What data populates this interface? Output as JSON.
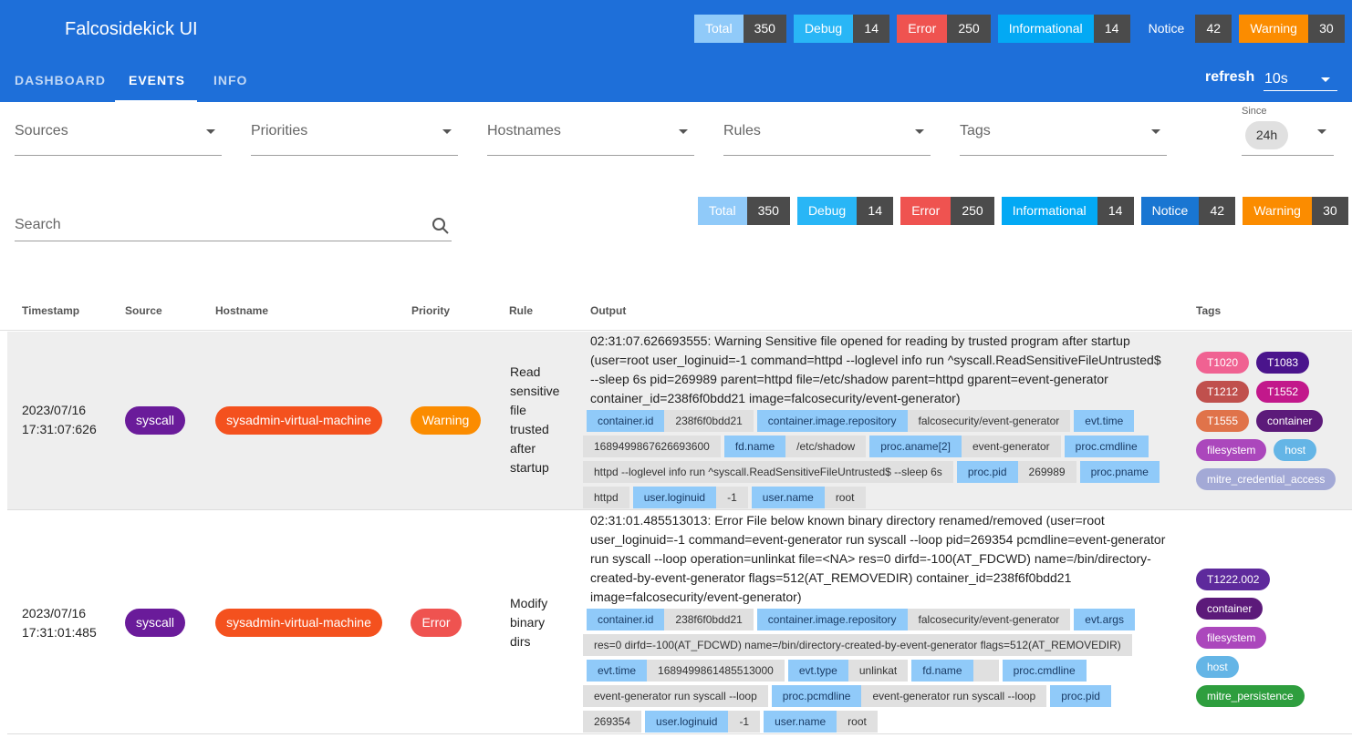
{
  "app": {
    "title": "Falcosidekick UI"
  },
  "header_counts": [
    {
      "label": "Total",
      "count": "350",
      "color": "#90caf9"
    },
    {
      "label": "Debug",
      "count": "14",
      "color": "#29b6f6"
    },
    {
      "label": "Error",
      "count": "250",
      "color": "#ef5350"
    },
    {
      "label": "Informational",
      "count": "14",
      "color": "#03a9f4"
    },
    {
      "label": "Notice",
      "count": "42",
      "color": "#1e6fd9"
    },
    {
      "label": "Warning",
      "count": "30",
      "color": "#fb8c00"
    }
  ],
  "tabs": [
    {
      "label": "DASHBOARD",
      "active": false
    },
    {
      "label": "EVENTS",
      "active": true
    },
    {
      "label": "INFO",
      "active": false
    }
  ],
  "refresh": {
    "label": "refresh",
    "value": "10s"
  },
  "filters": {
    "sources": "Sources",
    "priorities": "Priorities",
    "hostnames": "Hostnames",
    "rules": "Rules",
    "tags": "Tags",
    "since_label": "Since",
    "since_value": "24h"
  },
  "search": {
    "placeholder": "Search"
  },
  "body_counts": [
    {
      "label": "Total",
      "count": "350",
      "color": "#90caf9"
    },
    {
      "label": "Debug",
      "count": "14",
      "color": "#29b6f6"
    },
    {
      "label": "Error",
      "count": "250",
      "color": "#ef5350"
    },
    {
      "label": "Informational",
      "count": "14",
      "color": "#03a9f4"
    },
    {
      "label": "Notice",
      "count": "42",
      "color": "#1976d2"
    },
    {
      "label": "Warning",
      "count": "30",
      "color": "#fb8c00"
    }
  ],
  "table": {
    "headers": [
      "Timestamp",
      "Source",
      "Hostname",
      "Priority",
      "Rule",
      "Output",
      "Tags"
    ],
    "rows": [
      {
        "date": "2023/07/16",
        "time": "17:31:07:626",
        "source": "syscall",
        "hostname": "sysadmin-virtual-machine",
        "priority": "Warning",
        "priority_color": "#fb8c00",
        "rule": "Read sensitive file trusted after startup",
        "output": "02:31:07.626693555: Warning Sensitive file opened for reading by trusted program after startup (user=root user_loginuid=-1 command=httpd --loglevel info run ^syscall.ReadSensitiveFileUntrusted$ --sleep 6s pid=269989 parent=httpd file=/etc/shadow parent=httpd gparent=event-generator container_id=238f6f0bdd21 image=falcosecurity/event-generator)",
        "fields": [
          [
            "container.id",
            "238f6f0bdd21"
          ],
          [
            "container.image.repository",
            "falcosecurity/event-generator"
          ],
          [
            "evt.time",
            "1689499867626693600"
          ],
          [
            "fd.name",
            "/etc/shadow"
          ],
          [
            "proc.aname[2]",
            "event-generator"
          ],
          [
            "proc.cmdline",
            "httpd --loglevel info run ^syscall.ReadSensitiveFileUntrusted$ --sleep 6s"
          ],
          [
            "proc.pid",
            "269989"
          ],
          [
            "proc.pname",
            "httpd"
          ],
          [
            "user.loginuid",
            "-1"
          ],
          [
            "user.name",
            "root"
          ]
        ],
        "tags": [
          {
            "label": "T1020",
            "color": "#f06292"
          },
          {
            "label": "T1083",
            "color": "#4a148c"
          },
          {
            "label": "T1212",
            "color": "#c0504d"
          },
          {
            "label": "T1552",
            "color": "#c2188b"
          },
          {
            "label": "T1555",
            "color": "#e0734a"
          },
          {
            "label": "container",
            "color": "#5c1a7a"
          },
          {
            "label": "filesystem",
            "color": "#ab47bc"
          },
          {
            "label": "host",
            "color": "#64b5e6"
          },
          {
            "label": "mitre_credential_access",
            "color": "#a3a9d6"
          }
        ]
      },
      {
        "date": "2023/07/16",
        "time": "17:31:01:485",
        "source": "syscall",
        "hostname": "sysadmin-virtual-machine",
        "priority": "Error",
        "priority_color": "#ef5350",
        "rule": "Modify binary dirs",
        "output": "02:31:01.485513013: Error File below known binary directory renamed/removed (user=root user_loginuid=-1 command=event-generator run syscall --loop pid=269354 pcmdline=event-generator run syscall --loop operation=unlinkat file=<NA> res=0 dirfd=-100(AT_FDCWD) name=/bin/directory-created-by-event-generator flags=512(AT_REMOVEDIR) container_id=238f6f0bdd21 image=falcosecurity/event-generator)",
        "fields": [
          [
            "container.id",
            "238f6f0bdd21"
          ],
          [
            "container.image.repository",
            "falcosecurity/event-generator"
          ],
          [
            "evt.args",
            "res=0 dirfd=-100(AT_FDCWD) name=/bin/directory-created-by-event-generator flags=512(AT_REMOVEDIR)"
          ],
          [
            "evt.time",
            "1689499861485513000"
          ],
          [
            "evt.type",
            "unlinkat"
          ],
          [
            "fd.name",
            ""
          ],
          [
            "proc.cmdline",
            "event-generator run syscall --loop"
          ],
          [
            "proc.pcmdline",
            "event-generator run syscall --loop"
          ],
          [
            "proc.pid",
            "269354"
          ],
          [
            "user.loginuid",
            "-1"
          ],
          [
            "user.name",
            "root"
          ]
        ],
        "tags": [
          {
            "label": "T1222.002",
            "color": "#5e2a9c"
          },
          {
            "label": "container",
            "color": "#5c1a7a"
          },
          {
            "label": "filesystem",
            "color": "#ab47bc"
          },
          {
            "label": "host",
            "color": "#64b5e6"
          },
          {
            "label": "mitre_persistence",
            "color": "#2e9e3e"
          }
        ]
      }
    ]
  },
  "colors": {
    "appbar": "#1e6fd9",
    "source_pill": "#6a1b9a",
    "hostname_pill": "#f4511e"
  }
}
